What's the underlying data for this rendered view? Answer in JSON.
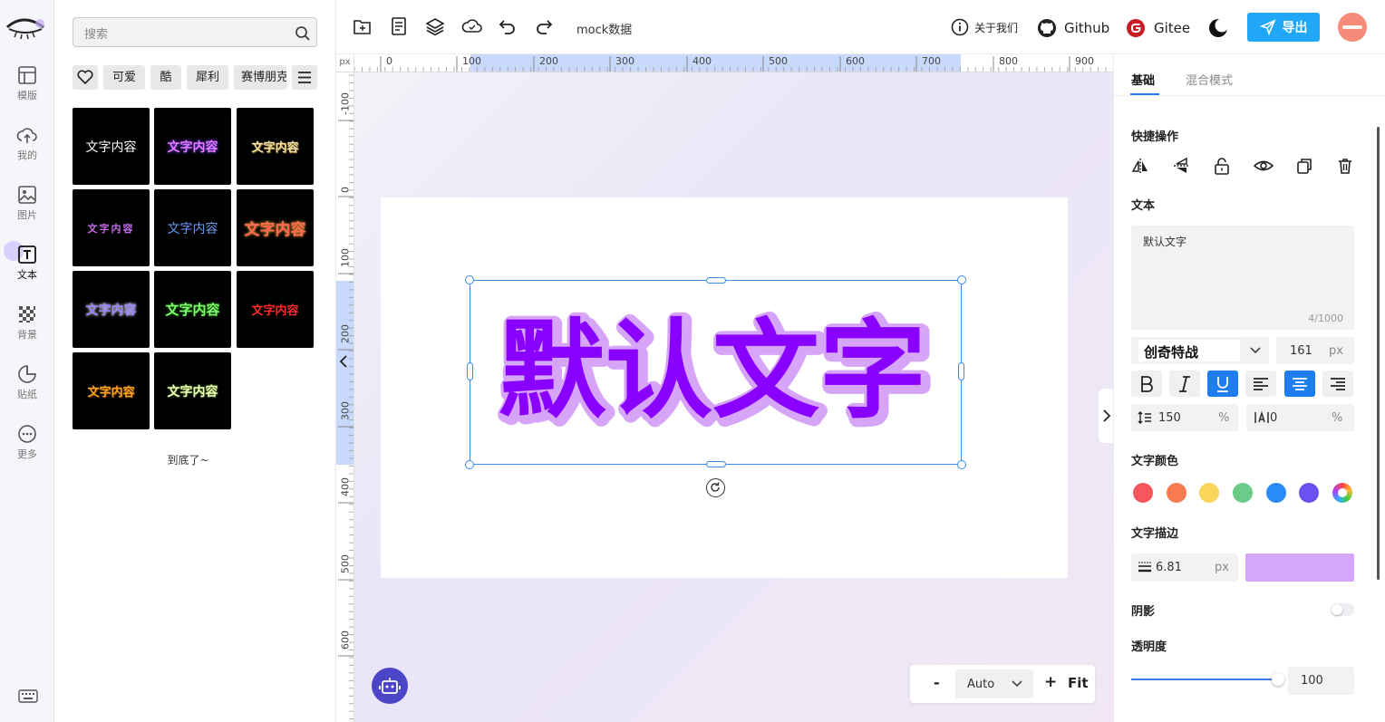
{
  "rail": {
    "items": [
      {
        "label": "模版",
        "icon": "template-icon"
      },
      {
        "label": "我的",
        "icon": "cloud-upload-icon"
      },
      {
        "label": "图片",
        "icon": "image-icon"
      },
      {
        "label": "文本",
        "icon": "text-icon"
      },
      {
        "label": "背景",
        "icon": "background-icon"
      },
      {
        "label": "贴纸",
        "icon": "sticker-icon"
      },
      {
        "label": "更多",
        "icon": "more-icon"
      }
    ]
  },
  "left_panel": {
    "search_placeholder": "搜索",
    "chips": [
      "可爱",
      "酷",
      "犀利",
      "赛博朋克"
    ],
    "tiles": [
      {
        "text": "文字内容",
        "color": "#ffffff"
      },
      {
        "text": "文字内容",
        "color": "#d86bff"
      },
      {
        "text": "文字内容",
        "color": "#e8d7a0"
      },
      {
        "text": "文字内容",
        "color": "#c66bf0"
      },
      {
        "text": "文字内容",
        "color": "#5a8ef0"
      },
      {
        "text": "文字内容",
        "color": "#ff5a4a"
      },
      {
        "text": "文字内容",
        "color": "#8f7bff"
      },
      {
        "text": "文字内容",
        "color": "#7dff6a"
      },
      {
        "text": "文字内容",
        "color": "#ff3333"
      },
      {
        "text": "文字内容",
        "color": "#f0a020"
      },
      {
        "text": "文字内容",
        "color": "#e9ffb0"
      }
    ],
    "end_text": "到底了~"
  },
  "toolbar": {
    "project_name": "mock数据",
    "about": "关于我们",
    "github": "Github",
    "gitee": "Gitee",
    "export": "导出"
  },
  "ruler": {
    "unit": "px",
    "h_labels": [
      "0",
      "100",
      "200",
      "300",
      "400",
      "500",
      "600",
      "700",
      "800",
      "900"
    ],
    "v_labels": [
      "-100",
      "0",
      "100",
      "200",
      "300",
      "400",
      "500",
      "600"
    ]
  },
  "canvas": {
    "text": "默认文字",
    "fill_color": "#8a00ff",
    "stroke_color": "#d6a5f8"
  },
  "zoom": {
    "minus": "-",
    "value": "Auto",
    "plus": "+",
    "fit": "Fit"
  },
  "right_panel": {
    "tabs": [
      "基础",
      "混合模式"
    ],
    "quick_ops_title": "快捷操作",
    "text_title": "文本",
    "text_value": "默认文字",
    "char_count": "4/1000",
    "font_name": "创奇特战",
    "font_size": "161",
    "font_size_unit": "px",
    "line_height": "150",
    "line_height_unit": "%",
    "letter_spacing": "0",
    "letter_spacing_unit": "%",
    "color_title": "文字颜色",
    "swatches": [
      "#f4585e",
      "#f87b4f",
      "#fcd65a",
      "#6ccb88",
      "#2a8af6",
      "#6b52f0"
    ],
    "stroke_title": "文字描边",
    "stroke_width": "6.81",
    "stroke_unit": "px",
    "stroke_color": "#d5a6f9",
    "shadow_title": "阴影",
    "opacity_title": "透明度",
    "opacity_value": "100",
    "opacity_level": 1.0
  }
}
